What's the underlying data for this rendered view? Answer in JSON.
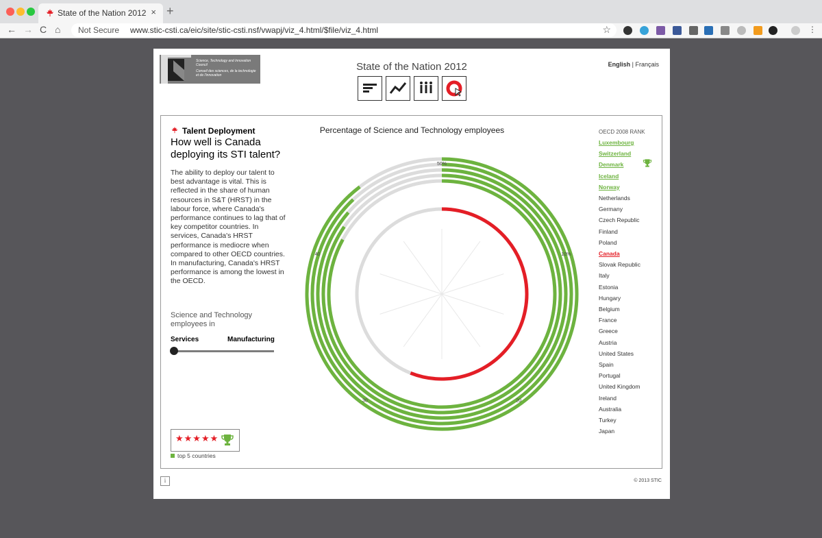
{
  "browser": {
    "tab_title": "State of the Nation 2012",
    "tab_close": "×",
    "new_tab": "+",
    "security": "Not Secure",
    "url": "www.stic-csti.ca/eic/site/stic-csti.nsf/vwapj/viz_4.html/$file/viz_4.html",
    "back": "←",
    "forward": "→",
    "reload": "C",
    "home": "⌂",
    "star": "☆"
  },
  "header": {
    "logo_line1": "Science, Technology and Innovation Council",
    "logo_line2": "Conseil des sciences, de la technologie et de l'innovation",
    "title": "State of the Nation 2012",
    "lang_en": "English",
    "lang_sep": "|",
    "lang_fr": "Français"
  },
  "left": {
    "section": "Talent Deployment",
    "question": "How well is Canada deploying its STI talent?",
    "description": "The ability to deploy our talent to best advantage is vital. This is reflected in the share of human resources in S&T (HRST) in the labour force, where Canada's performance continues to lag that of key competitor countries. In services, Canada's HRST performance is mediocre when compared to other OECD countries. In manufacturing, Canada's HRST performance is among the lowest in the OECD.",
    "toggle_label": "Science and Technology employees in",
    "opt_services": "Services",
    "opt_manufacturing": "Manufacturing",
    "stars": "★★★★★",
    "legend": "top 5 countries"
  },
  "chart_data": {
    "type": "radial",
    "title": "Percentage of Science and Technology employees",
    "tick_labels": [
      "10%",
      "20",
      "30",
      "40",
      "50%"
    ],
    "ticks": [
      10,
      20,
      30,
      40,
      50
    ],
    "max": 50,
    "series": [
      {
        "name": "Luxembourg",
        "value": 44.8,
        "color": "#6db33f"
      },
      {
        "name": "Switzerland",
        "value": 44.0,
        "color": "#6db33f"
      },
      {
        "name": "Denmark",
        "value": 43.2,
        "color": "#6db33f"
      },
      {
        "name": "Iceland",
        "value": 42.3,
        "color": "#6db33f"
      },
      {
        "name": "Norway",
        "value": 41.5,
        "color": "#6db33f"
      },
      {
        "name": "Canada",
        "value": 28.0,
        "color": "#e41e26"
      }
    ]
  },
  "ranking": {
    "header": "OECD 2008 RANK",
    "countries": [
      "Luxembourg",
      "Switzerland",
      "Denmark",
      "Iceland",
      "Norway",
      "Netherlands",
      "Germany",
      "Czech Republic",
      "Finland",
      "Poland",
      "Canada",
      "Slovak Republic",
      "Italy",
      "Estonia",
      "Hungary",
      "Belgium",
      "France",
      "Greece",
      "Austria",
      "United States",
      "Spain",
      "Portugal",
      "United Kingdom",
      "Ireland",
      "Australia",
      "Turkey",
      "Japan"
    ]
  },
  "footer": {
    "copyright": "© 2013 STIC",
    "info": "i"
  },
  "colors": {
    "green": "#6db33f",
    "red": "#e41e26",
    "grey": "#dcdcdc"
  }
}
